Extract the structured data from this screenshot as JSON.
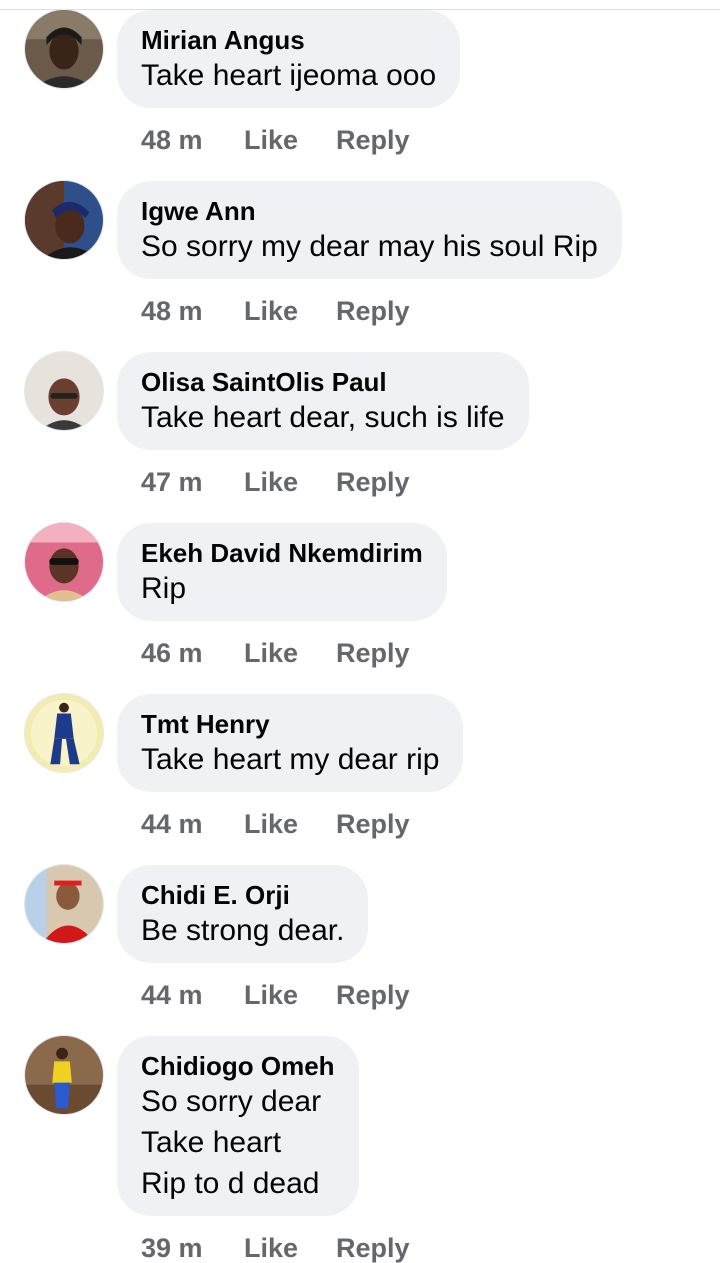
{
  "comments": [
    {
      "author": "Mirian Angus",
      "lines": [
        "Take heart ijeoma ooo"
      ],
      "time": "48 m",
      "like": "Like",
      "reply": "Reply"
    },
    {
      "author": "Igwe Ann",
      "lines": [
        "So sorry my dear may his soul Rip"
      ],
      "time": "48 m",
      "like": "Like",
      "reply": "Reply"
    },
    {
      "author": "Olisa SaintOlis Paul",
      "lines": [
        "Take heart dear, such is life"
      ],
      "time": "47 m",
      "like": "Like",
      "reply": "Reply"
    },
    {
      "author": "Ekeh David Nkemdirim",
      "lines": [
        "Rip"
      ],
      "time": "46 m",
      "like": "Like",
      "reply": "Reply"
    },
    {
      "author": "Tmt Henry",
      "lines": [
        "Take heart my dear rip"
      ],
      "time": "44 m",
      "like": "Like",
      "reply": "Reply"
    },
    {
      "author": "Chidi E. Orji",
      "lines": [
        "Be strong dear."
      ],
      "time": "44 m",
      "like": "Like",
      "reply": "Reply"
    },
    {
      "author": "Chidiogo Omeh",
      "lines": [
        "So sorry dear",
        "Take heart",
        "Rip to d dead"
      ],
      "time": "39 m",
      "like": "Like",
      "reply": "Reply"
    }
  ]
}
